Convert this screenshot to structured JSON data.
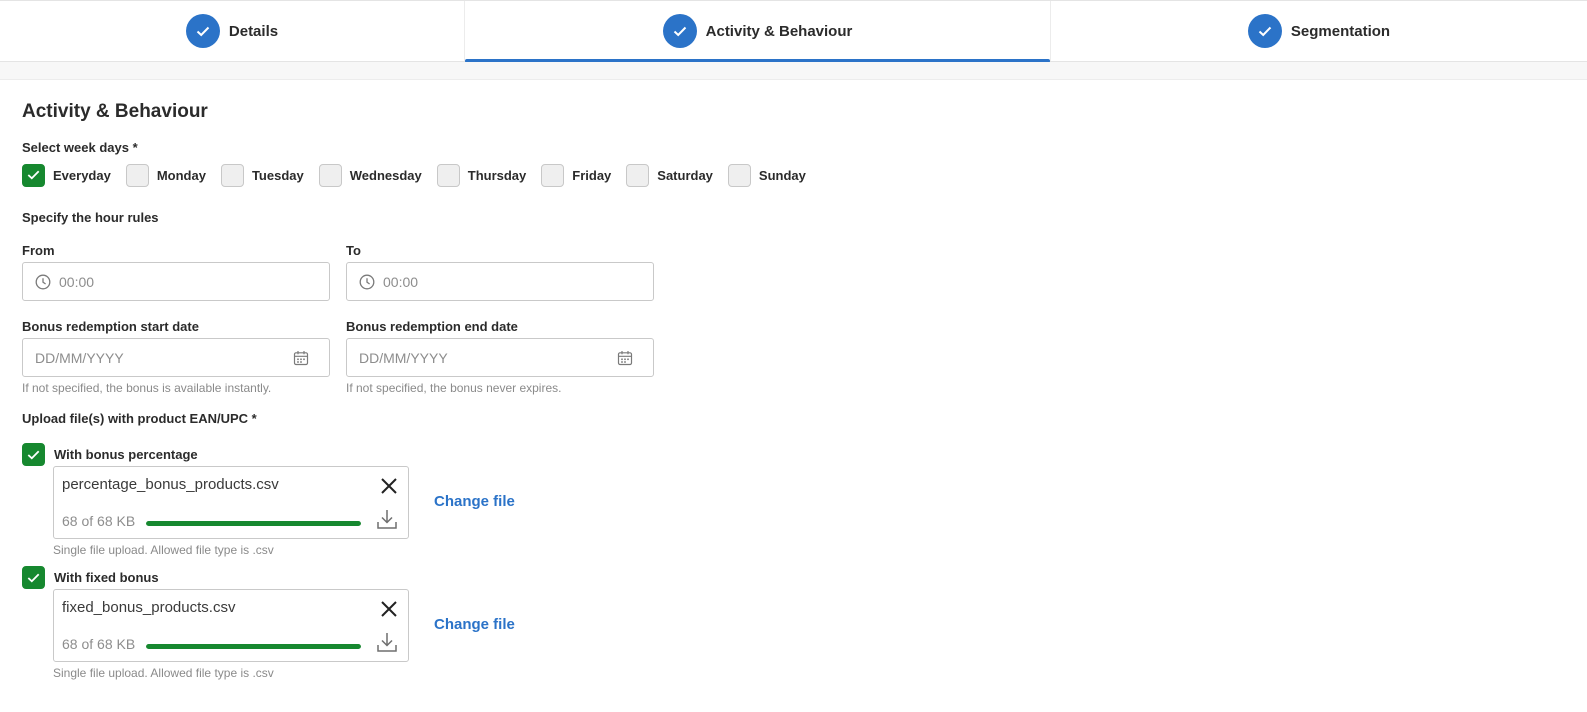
{
  "stepper": {
    "steps": [
      {
        "label": "Details",
        "state": "completed"
      },
      {
        "label": "Activity & Behaviour",
        "state": "active"
      },
      {
        "label": "Segmentation",
        "state": "completed"
      }
    ]
  },
  "section_title": "Activity & Behaviour",
  "weekdays": {
    "label": "Select week days *",
    "options": [
      {
        "label": "Everyday",
        "checked": true
      },
      {
        "label": "Monday",
        "checked": false
      },
      {
        "label": "Tuesday",
        "checked": false
      },
      {
        "label": "Wednesday",
        "checked": false
      },
      {
        "label": "Thursday",
        "checked": false
      },
      {
        "label": "Friday",
        "checked": false
      },
      {
        "label": "Saturday",
        "checked": false
      },
      {
        "label": "Sunday",
        "checked": false
      }
    ]
  },
  "hours": {
    "label": "Specify the hour rules",
    "from": {
      "label": "From",
      "placeholder": "00:00",
      "icon": "clock-icon"
    },
    "to": {
      "label": "To",
      "placeholder": "00:00",
      "icon": "clock-icon"
    }
  },
  "dates": {
    "start": {
      "label": "Bonus redemption start date",
      "placeholder": "DD/MM/YYYY",
      "hint": "If not specified, the bonus is available instantly.",
      "icon": "calendar-icon"
    },
    "end": {
      "label": "Bonus redemption end date",
      "placeholder": "DD/MM/YYYY",
      "hint": "If not specified, the bonus never expires.",
      "icon": "calendar-icon"
    }
  },
  "upload": {
    "label": "Upload file(s) with product EAN/UPC *",
    "items": [
      {
        "checkbox_label": "With bonus percentage",
        "checked": true,
        "file_name": "percentage_bonus_products.csv",
        "size_text": "68 of 68 KB",
        "progress": 1.0,
        "change_label": "Change file",
        "hint": "Single file upload. Allowed file type is .csv"
      },
      {
        "checkbox_label": "With fixed bonus",
        "checked": true,
        "file_name": "fixed_bonus_products.csv",
        "size_text": "68 of 68 KB",
        "progress": 1.0,
        "change_label": "Change file",
        "hint": "Single file upload. Allowed file type is .csv"
      }
    ]
  },
  "colors": {
    "accent": "#2b73c8",
    "success": "#16882f"
  }
}
